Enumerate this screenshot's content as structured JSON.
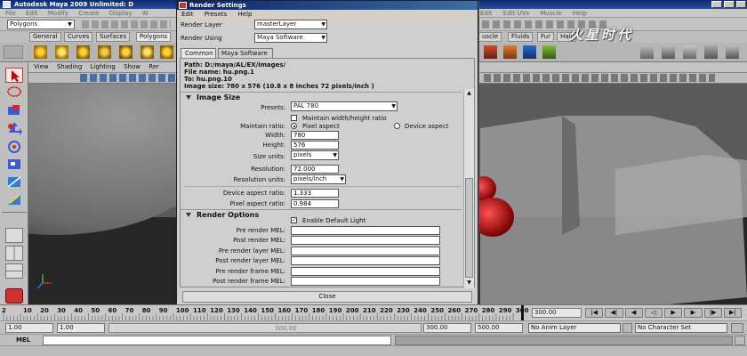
{
  "maya": {
    "title": "Autodesk Maya 2009 Unlimited: D",
    "menus": [
      "File",
      "Edit",
      "Modify",
      "Create",
      "Display",
      "W"
    ],
    "menus_right": [
      "Edit",
      "Edit UVs",
      "Muscle",
      "Help"
    ],
    "mode": "Polygons",
    "shelf_tabs": [
      "General",
      "Curves",
      "Surfaces",
      "Polygons"
    ],
    "shelf_tabs_right": [
      "uscle",
      "Fluids",
      "Fur",
      "Hair"
    ],
    "viewport_menus": [
      "View",
      "Shading",
      "Lighting",
      "Show",
      "Rer"
    ],
    "ruler_ticks": [
      "2",
      "10",
      "20",
      "30",
      "40",
      "50",
      "60",
      "70",
      "80",
      "90",
      "100",
      "110",
      "120",
      "130",
      "140",
      "150",
      "160",
      "170",
      "180",
      "190",
      "200",
      "210",
      "220",
      "230",
      "240",
      "250",
      "260",
      "270",
      "280",
      "290",
      "300"
    ],
    "current_frame": "300.00",
    "range_start": "1.00",
    "range_start_inner": "1.00",
    "range_end_inner": "300.00",
    "range_end": "500.00",
    "range_slider_label": "300.00",
    "anim_layer": "No Anim Layer",
    "character_set": "No Character Set",
    "cmd_label": "MEL",
    "watermark": "火星时代"
  },
  "render_settings": {
    "title": "Render Settings",
    "menus": [
      "Edit",
      "Presets",
      "Help"
    ],
    "render_layer_label": "Render Layer",
    "render_layer_value": "masterLayer",
    "render_using_label": "Render Using",
    "render_using_value": "Maya Software",
    "tabs": [
      "Common",
      "Maya Software"
    ],
    "path": "Path: D:/maya/AL/EX/images/",
    "file_name": "File name:  hu.png.1",
    "to": "To:              hu.png.10",
    "image_size_info": "Image size: 780 x 576 (10.8 x 8 inches 72 pixels/inch )",
    "image_size": {
      "header": "Image Size",
      "presets_label": "Presets:",
      "presets_value": "PAL 780",
      "maintain_wh_label": "Maintain width/height ratio",
      "maintain_ratio_label": "Maintain ratio:",
      "pixel_aspect_label": "Pixel aspect",
      "device_aspect_label": "Device aspect",
      "width_label": "Width:",
      "width_value": "780",
      "height_label": "Height:",
      "height_value": "576",
      "size_units_label": "Size units:",
      "size_units_value": "pixels",
      "resolution_label": "Resolution:",
      "resolution_value": "72.000",
      "resolution_units_label": "Resolution units:",
      "resolution_units_value": "pixels/inch",
      "device_aspect_ratio_label": "Device aspect ratio:",
      "device_aspect_ratio_value": "1.333",
      "pixel_aspect_ratio_label": "Pixel aspect ratio:",
      "pixel_aspect_ratio_value": "0.984"
    },
    "render_options": {
      "header": "Render Options",
      "enable_default_light_label": "Enable Default Light",
      "mel_labels": [
        "Pre render MEL:",
        "Post render MEL:",
        "Pre render layer MEL:",
        "Post render layer MEL:",
        "Pre render frame MEL:",
        "Post render frame MEL:"
      ]
    },
    "close_label": "Close"
  },
  "colors": {
    "title_bar": "#0a246a",
    "viewport_bg": "#6b6b6b",
    "red_object": "#c8141a"
  }
}
